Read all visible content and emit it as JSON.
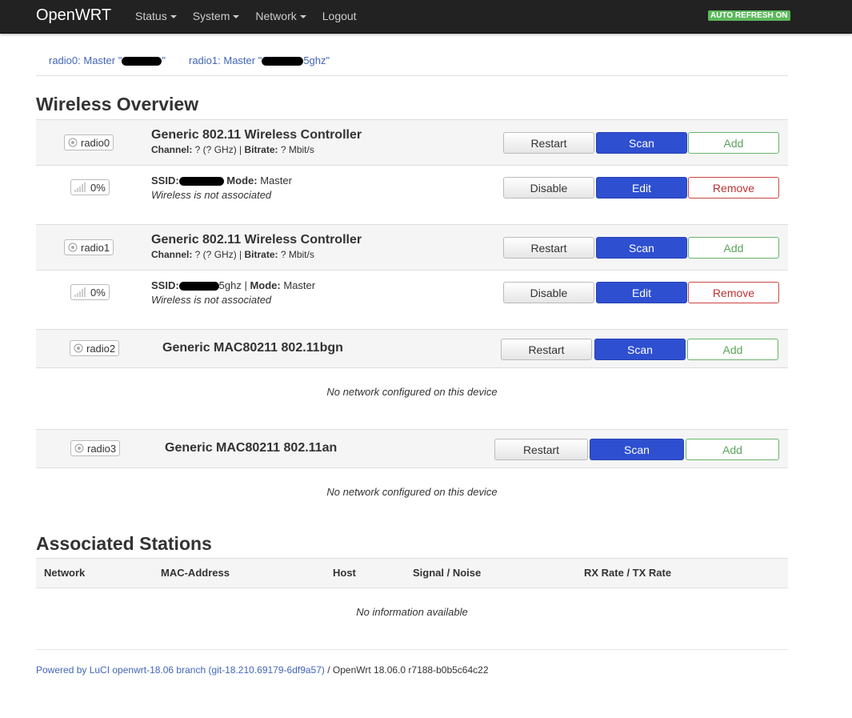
{
  "nav": {
    "brand": "OpenWRT",
    "menu": [
      "Status",
      "System",
      "Network",
      "Logout"
    ],
    "auto_refresh": "AUTO REFRESH ON"
  },
  "tabs": [
    {
      "prefix": "radio0: Master \"",
      "suffix": "\""
    },
    {
      "prefix": "radio1: Master \"",
      "suffix": "5ghz\""
    }
  ],
  "overview_title": "Wireless Overview",
  "radios": [
    {
      "badge": "radio0",
      "title": "Generic 802.11 Wireless Controller",
      "channel_label": "Channel:",
      "channel_value": " ? (? GHz) | ",
      "bitrate_label": "Bitrate:",
      "bitrate_value": " ? Mbit/s",
      "buttons": [
        "Restart",
        "Scan",
        "Add"
      ],
      "network": {
        "signal": "0%",
        "ssid_label": "SSID:",
        "ssid_suffix": "",
        "mode_label": "Mode:",
        "mode_value": " Master",
        "status": "Wireless is not associated",
        "buttons": [
          "Disable",
          "Edit",
          "Remove"
        ]
      }
    },
    {
      "badge": "radio1",
      "title": "Generic 802.11 Wireless Controller",
      "channel_label": "Channel:",
      "channel_value": " ? (? GHz) | ",
      "bitrate_label": "Bitrate:",
      "bitrate_value": " ? Mbit/s",
      "buttons": [
        "Restart",
        "Scan",
        "Add"
      ],
      "network": {
        "signal": "0%",
        "ssid_label": "SSID:",
        "ssid_suffix": "5ghz | ",
        "mode_label": "Mode:",
        "mode_value": " Master",
        "status": "Wireless is not associated",
        "buttons": [
          "Disable",
          "Edit",
          "Remove"
        ]
      }
    },
    {
      "badge": "radio2",
      "title": "Generic MAC80211 802.11bgn",
      "buttons": [
        "Restart",
        "Scan",
        "Add"
      ],
      "empty": "No network configured on this device"
    },
    {
      "badge": "radio3",
      "title": "Generic MAC80211 802.11an",
      "buttons": [
        "Restart",
        "Scan",
        "Add"
      ],
      "empty": "No network configured on this device"
    }
  ],
  "stations": {
    "title": "Associated Stations",
    "columns": [
      "Network",
      "MAC-Address",
      "Host",
      "Signal / Noise",
      "RX Rate / TX Rate"
    ],
    "empty": "No information available"
  },
  "footer": {
    "link": "Powered by LuCI openwrt-18.06 branch (git-18.210.69179-6df9a57)",
    "text": " / OpenWrt 18.06.0 r7188-b0b5c64c22"
  },
  "colors": {
    "navbar": "#222222",
    "primary_button": "#2e4fd0",
    "add_button": "#5aa55a",
    "remove_button": "#bb3333",
    "link": "#4365b8",
    "auto_refresh": "#5cb85c"
  }
}
